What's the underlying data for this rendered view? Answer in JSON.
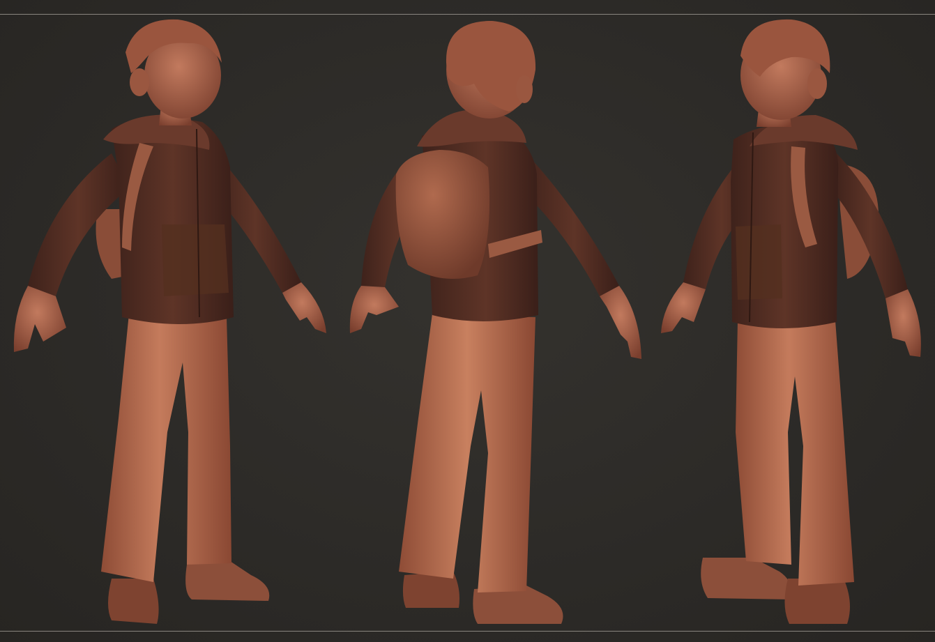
{
  "scene": {
    "background": "#2d2b28",
    "frame_line_color": "#8a8680",
    "views": [
      {
        "id": "front-three-quarter",
        "label": ""
      },
      {
        "id": "back-three-quarter",
        "label": ""
      },
      {
        "id": "side-three-quarter",
        "label": ""
      }
    ]
  },
  "palette": {
    "skin": "#a8624a",
    "skin_shadow": "#7a3f2e",
    "hair": "#9a553e",
    "hoodie": "#4a2a22",
    "hoodie_light": "#6a3a2c",
    "pants": "#b56a4e",
    "pants_shadow": "#8a4a34",
    "boots": "#8c4f3a",
    "backpack": "#9a5a42"
  }
}
